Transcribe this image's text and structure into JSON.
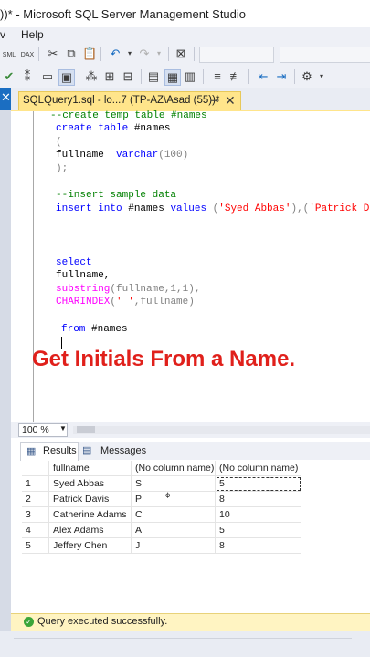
{
  "window": {
    "title": "))* - Microsoft SQL Server Management Studio"
  },
  "menu": {
    "items": [
      "v",
      "Help"
    ]
  },
  "toolbar": {
    "labels": {
      "sml": "SML",
      "dax": "DAX"
    }
  },
  "tab": {
    "label": "SQLQuery1.sql - lo...7 (TP-AZ\\Asad (55))*",
    "pin": "⊸",
    "close": "✕"
  },
  "code": {
    "l1": "--create temp table #names",
    "l2_kw": "create table",
    "l2_id": " #names",
    "l3": "(",
    "l4_id": "fullname  ",
    "l4_kw": "varchar",
    "l4_rest": "(100)",
    "l5": ");",
    "l6": "--insert sample data",
    "l7_kw1": "insert into",
    "l7_id": " #names ",
    "l7_kw2": "values",
    "l7_p1": " (",
    "l7_s1": "'Syed Abbas'",
    "l7_p2": "),(",
    "l7_s2": "'Patrick Dav",
    "l8_kw": "select",
    "l9": "fullname,",
    "l10_fn": "substring",
    "l10_rest": "(fullname,1,1),",
    "l11_fn": "CHARINDEX",
    "l11_p": "(",
    "l11_s": "' '",
    "l11_rest": ",fullname)",
    "l12_kw": "from",
    "l12_id": " #names"
  },
  "overlay": {
    "text": "Get Initials From a Name."
  },
  "zoom": {
    "value": "100 %"
  },
  "results_tabs": {
    "results": "Results",
    "messages": "Messages"
  },
  "grid": {
    "headers": [
      "fullname",
      "(No column name)",
      "(No column name)"
    ],
    "rows": [
      {
        "n": "1",
        "fullname": "Syed Abbas",
        "c1": "S",
        "c2": "5"
      },
      {
        "n": "2",
        "fullname": "Patrick Davis",
        "c1": "P",
        "c2": "8"
      },
      {
        "n": "3",
        "fullname": "Catherine Adams",
        "c1": "C",
        "c2": "10"
      },
      {
        "n": "4",
        "fullname": "Alex Adams",
        "c1": "A",
        "c2": "5"
      },
      {
        "n": "5",
        "fullname": "Jeffery Chen",
        "c1": "J",
        "c2": "8"
      }
    ]
  },
  "status": {
    "text": "Query executed successfully."
  },
  "colors": {
    "accent_tab": "#ffe58b",
    "overlay_red": "#e0201b",
    "status_bg": "#fff4c2",
    "keyword": "#0000ff",
    "comment": "#008000",
    "function": "#ff00ff",
    "string": "#ff0000"
  }
}
